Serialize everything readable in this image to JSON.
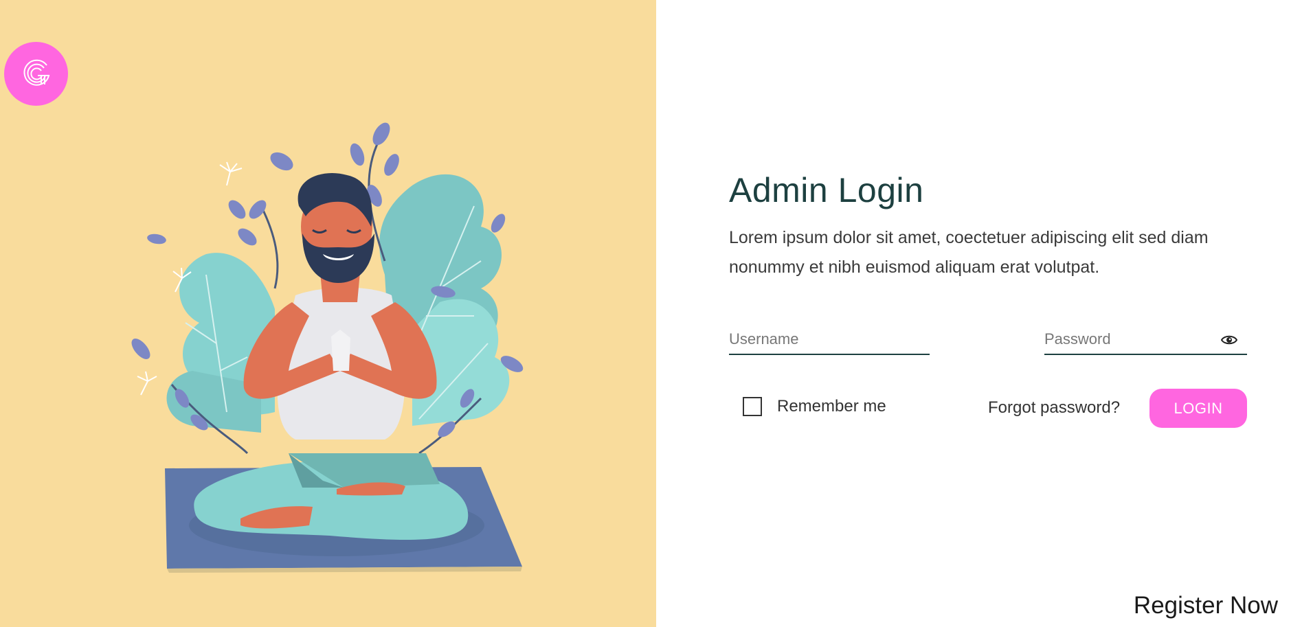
{
  "login": {
    "title": "Admin Login",
    "description": "Lorem ipsum dolor sit amet, coectetuer adipiscing elit sed diam nonummy et nibh euismod aliquam erat volutpat.",
    "username_placeholder": "Username",
    "password_placeholder": "Password",
    "remember_label": "Remember me",
    "forgot_label": "Forgot password?",
    "login_label": "LOGIN",
    "register_label": "Register Now"
  },
  "icons": {
    "logo": "g-logo-icon",
    "show_password": "eye-icon",
    "illustration": "meditation-illustration"
  },
  "colors": {
    "left_panel_bg": "#f9dc9c",
    "accent": "#ff66e0",
    "title": "#1d4040",
    "underline": "#1d4040"
  }
}
